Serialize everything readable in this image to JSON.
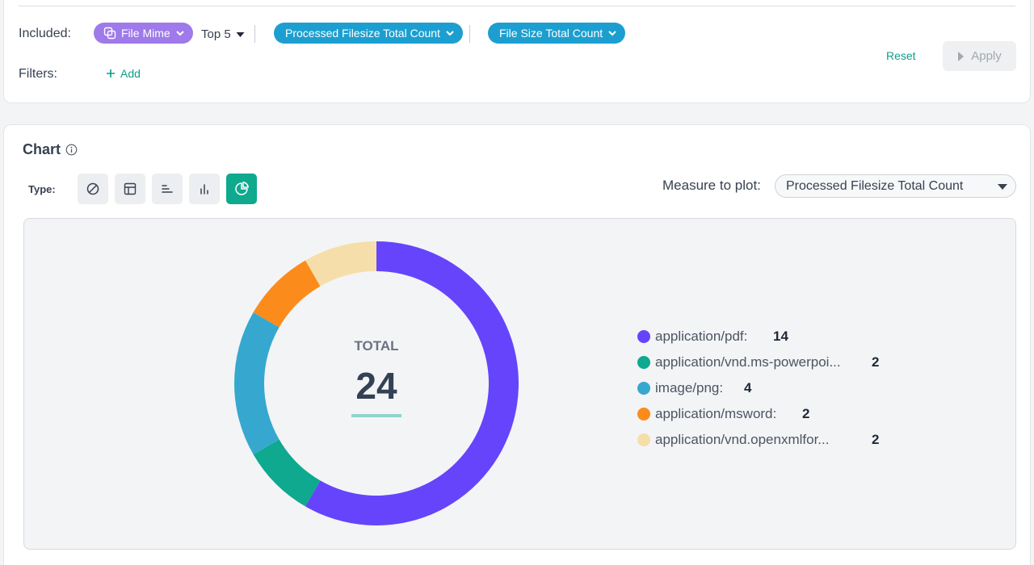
{
  "query": {
    "included_label": "Included:",
    "filters_label": "Filters:",
    "dimension_pill": "File Mime",
    "top_n": "Top 5",
    "measures": [
      "Processed Filesize Total Count",
      "File Size Total Count"
    ],
    "add_filter": "Add",
    "reset": "Reset",
    "apply": "Apply"
  },
  "chart_panel": {
    "title": "Chart",
    "type_label": "Type:",
    "type_buttons": [
      "none-icon",
      "table-icon",
      "horizontal-bar-icon",
      "bar-chart-icon",
      "pie-chart-icon"
    ],
    "active_type": "pie-chart-icon",
    "measure_label": "Measure to plot:",
    "measure_value": "Processed Filesize Total Count",
    "total_label": "TOTAL",
    "total_value": "24"
  },
  "chart_data": {
    "type": "pie",
    "donut": true,
    "categories": [
      "application/pdf",
      "application/vnd.ms-powerpoi...",
      "image/png",
      "application/msword",
      "application/vnd.openxmlfor..."
    ],
    "legend_labels": [
      "application/pdf:",
      "application/vnd.ms-powerpoi...",
      "image/png:",
      "application/msword:",
      "application/vnd.openxmlfor..."
    ],
    "values": [
      14,
      2,
      4,
      2,
      2
    ],
    "colors": [
      "#6644fb",
      "#0ea98f",
      "#36a8cf",
      "#fb8c1c",
      "#f6deaa"
    ],
    "total": 24,
    "legend_position": "right"
  },
  "colors": {
    "accent": "#0fa98e",
    "pill_purple": "#9f7aea",
    "pill_blue": "#1c9fd0"
  }
}
